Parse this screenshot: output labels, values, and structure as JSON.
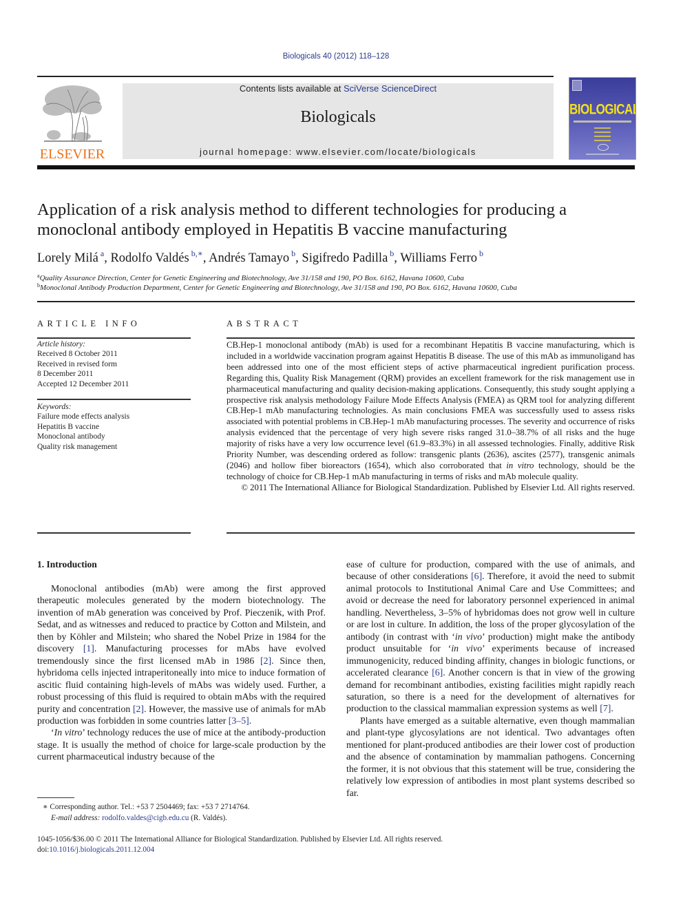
{
  "header": {
    "citation": "Biologicals 40 (2012) 118–128",
    "contents_prefix": "Contents lists available at ",
    "contents_link": "SciVerse ScienceDirect",
    "journal_name": "Biologicals",
    "homepage_prefix": "journal homepage: ",
    "homepage_url": "www.elsevier.com/locate/biologicals",
    "publisher_logo": "ELSEVIER",
    "cover_title": "BIOLOGICALS",
    "colors": {
      "brand_orange": "#e9711c",
      "link_blue": "#2a3a8c",
      "banner_gray": "#e6e6e6",
      "cover_yellow": "#f2e21a"
    }
  },
  "article": {
    "title": "Application of a risk analysis method to different technologies for producing a monoclonal antibody employed in Hepatitis B vaccine manufacturing",
    "authors": [
      {
        "name": "Lorely Milá",
        "aff": "a"
      },
      {
        "name": "Rodolfo Valdés",
        "aff": "b,∗"
      },
      {
        "name": "Andrés Tamayo",
        "aff": "b"
      },
      {
        "name": "Sigifredo Padilla",
        "aff": "b"
      },
      {
        "name": "Williams Ferro",
        "aff": "b"
      }
    ],
    "affiliations": [
      {
        "key": "a",
        "text": "Quality Assurance Direction, Center for Genetic Engineering and Biotechnology, Ave 31/158 and 190, PO Box. 6162, Havana 10600, Cuba"
      },
      {
        "key": "b",
        "text": "Monoclonal Antibody Production Department, Center for Genetic Engineering and Biotechnology, Ave 31/158 and 190, PO Box. 6162, Havana 10600, Cuba"
      }
    ]
  },
  "article_info": {
    "heading": "ARTICLE INFO",
    "history_label": "Article history:",
    "history": [
      "Received 8 October 2011",
      "Received in revised form",
      "8 December 2011",
      "Accepted 12 December 2011"
    ],
    "keywords_label": "Keywords:",
    "keywords": [
      "Failure mode effects analysis",
      "Hepatitis B vaccine",
      "Monoclonal antibody",
      "Quality risk management"
    ]
  },
  "abstract": {
    "heading": "ABSTRACT",
    "text_before_italic": "CB.Hep-1 monoclonal antibody (mAb) is used for a recombinant Hepatitis B vaccine manufacturing, which is included in a worldwide vaccination program against Hepatitis B disease. The use of this mAb as immunoligand has been addressed into one of the most efficient steps of active pharmaceutical ingre­dient purification process. Regarding this, Quality Risk Management (QRM) provides an excellent framework for the risk management use in pharmaceutical manufacturing and quality decision-making applications. Consequently, this study sought applying a prospective risk analysis methodology Failure Mode Effects Analysis (FMEA) as QRM tool for analyzing different CB.Hep-1 mAb manufacturing tech­nologies. As main conclusions FMEA was successfully used to assess risks associated with potential problems in CB.Hep-1 mAb manufacturing processes. The severity and occurrence of risks analysis evidenced that the percentage of very high severe risks ranged 31.0–38.7% of all risks and the huge majority of risks have a very low occurrence level (61.9–83.3%) in all assessed technologies. Finally, additive Risk Priority Number, was descending ordered as follow: transgenic plants (2636), ascites (2577), transgenic animals (2046) and hollow fiber bioreactors (1654), which also corroborated that ",
    "italic": "in vitro",
    "text_after_italic": " technology, should be the technology of choice for CB.Hep-1 mAb manufacturing in terms of risks and mAb molecule quality.",
    "copyright": "© 2011 The International Alliance for Biological Standardization. Published by Elsevier Ltd. All rights reserved."
  },
  "introduction": {
    "heading": "1.  Introduction",
    "left_p1": [
      {
        "t": "Monoclonal antibodies (mAb) were among the first approved therapeutic molecules generated by the modern biotechnology. The invention of mAb generation was conceived by Prof. Pieczenik, with Prof. Sedat, and as witnesses and reduced to practice by Cotton and Milstein, and then by Köhler and Milstein; who shared the Nobel Prize in 1984 for the discovery "
      },
      {
        "ref": "[1]"
      },
      {
        "t": ". Manufacturing processes for mAbs have evolved tremendously since the first licensed mAb in 1986 "
      },
      {
        "ref": "[2]"
      },
      {
        "t": ". Since then, hybridoma cells injected intraperitoneally into mice to induce formation of ascitic fluid containing high-levels of mAbs was widely used. Further, a robust processing of this fluid is required to obtain mAbs with the required purity and concentra­tion "
      },
      {
        "ref": "[2]"
      },
      {
        "t": ". However, the massive use of animals for mAb production was forbidden in some countries latter "
      },
      {
        "ref": "[3–5]"
      },
      {
        "t": "."
      }
    ],
    "left_p2": [
      {
        "t": "‘"
      },
      {
        "i": "In vitro"
      },
      {
        "t": "’ technology reduces the use of mice at the antibody-production stage. It is usually the method of choice for large-scale production by the current pharmaceutical industry because of the"
      }
    ],
    "right_p1": [
      {
        "t": "ease of culture for production, compared with the use of animals, and because of other considerations "
      },
      {
        "ref": "[6]"
      },
      {
        "t": ". Therefore, it avoid the need to submit animal protocols to Institutional Animal Care and Use Committees; and avoid or decrease the need for laboratory personnel experienced in animal handling. Nevertheless, 3–5% of hybridomas does not grow well in culture or are lost in culture. In addition, the loss of the proper glycosylation of the antibody (in contrast with ‘"
      },
      {
        "i": "in vivo"
      },
      {
        "t": "’ production) might make the antibody product unsuitable for ‘"
      },
      {
        "i": "in vivo"
      },
      {
        "t": "’ experiments because of increased immunogenicity, reduced binding affinity, changes in biologic functions, or accelerated clearance "
      },
      {
        "ref": "[6]"
      },
      {
        "t": ". Another concern is that in view of the growing demand for recombinant antibodies, existing facilities might rapidly reach saturation, so there is a need for the development of alternatives for production to the classical mammalian expression systems as well "
      },
      {
        "ref": "[7]"
      },
      {
        "t": "."
      }
    ],
    "right_p2": [
      {
        "t": "Plants have emerged as a suitable alternative, even though mammalian and plant-type glycosylations are not identical. Two advantages often mentioned for plant-produced antibodies are their lower cost of production and the absence of contamination by mammalian pathogens. Concerning the former, it is not obvious that this statement will be true, considering the relatively low expression of antibodies in most plant systems described so far."
      }
    ]
  },
  "footnote": {
    "marker": "∗",
    "corresponding": "Corresponding author. Tel.: +53 7 2504469; fax: +53 7 2714764.",
    "email_label": "E-mail address:",
    "email": "rodolfo.valdes@cigb.edu.cu",
    "email_suffix": " (R. Valdés)."
  },
  "bottom": {
    "issn_line": "1045-1056/$36.00 © 2011 The International Alliance for Biological Standardization. Published by Elsevier Ltd. All rights reserved.",
    "doi_label": "doi:",
    "doi": "10.1016/j.biologicals.2011.12.004"
  }
}
